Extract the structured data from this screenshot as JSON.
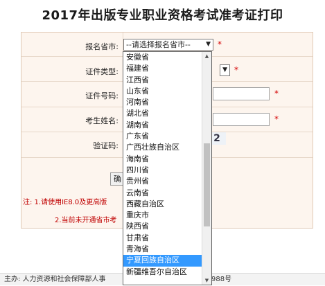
{
  "page": {
    "title": "2017年出版专业职业资格考试准考证打印"
  },
  "form": {
    "province_label": "报名省市:",
    "province_value": "--请选择报名省市--",
    "idtype_label": "证件类型:",
    "idnum_label": "证件号码:",
    "name_label": "考生姓名:",
    "captcha_label": "验证码:",
    "captcha_partial": "2",
    "required_mark": "*",
    "submit_partial": "确"
  },
  "notes": {
    "note1": "注: 1.请使用IE8.0及更高版",
    "note2": "2.当前未开通省市考"
  },
  "footer": {
    "left": "主办: 人力资源和社会保障部人事",
    "right": "988号"
  },
  "dropdown": {
    "options": [
      "安徽省",
      "福建省",
      "江西省",
      "山东省",
      "河南省",
      "湖北省",
      "湖南省",
      "广东省",
      "广西壮族自治区",
      "海南省",
      "四川省",
      "贵州省",
      "云南省",
      "西藏自治区",
      "重庆市",
      "陕西省",
      "甘肃省",
      "青海省",
      "宁夏回族自治区",
      "新疆维吾尔自治区"
    ],
    "highlighted": "宁夏回族自治区",
    "scroll_position": 0.62
  }
}
